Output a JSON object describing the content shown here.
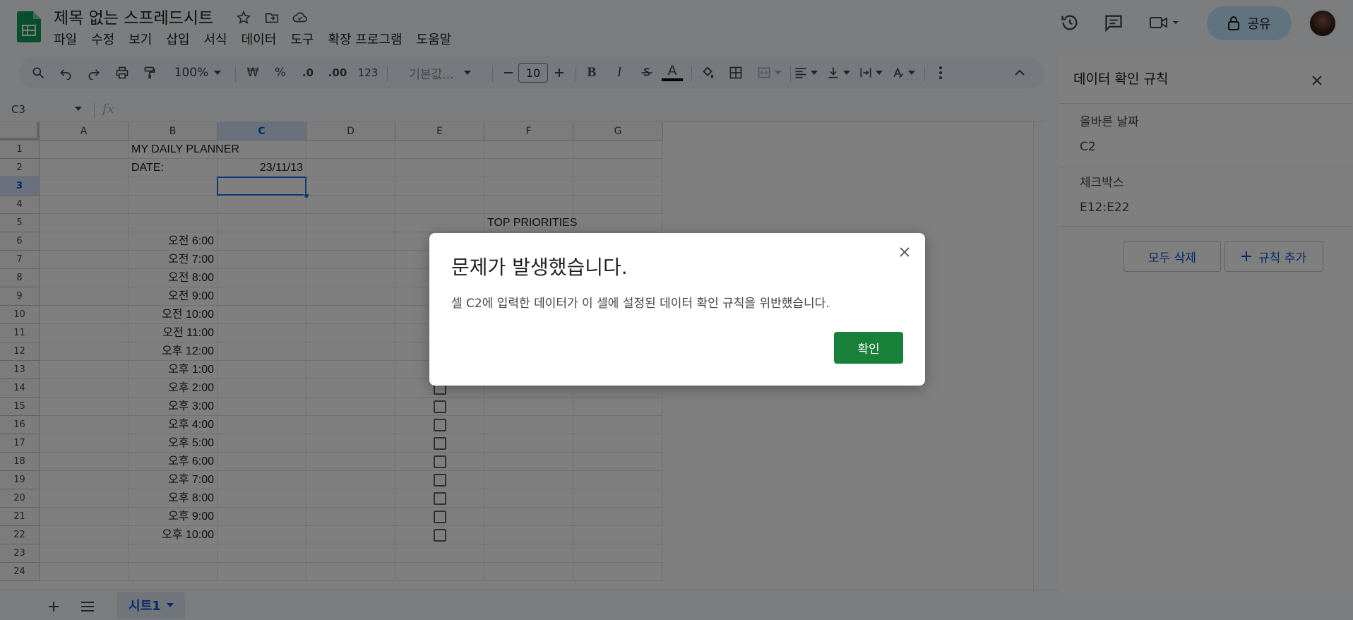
{
  "app": {
    "brand_color": "#0f9d58"
  },
  "header": {
    "doc_title": "제목 없는 스프레드시트",
    "menu": [
      "파일",
      "수정",
      "보기",
      "삽입",
      "서식",
      "데이터",
      "도구",
      "확장 프로그램",
      "도움말"
    ],
    "share_label": "공유"
  },
  "toolbar": {
    "zoom": "100%",
    "currency": "₩",
    "percent": "%",
    "decimal_decrease": ".0",
    "decimal_increase": ".00",
    "format_number": "123",
    "font": "기본값...",
    "font_size": "10"
  },
  "formula": {
    "namebox": "C3",
    "fx": "fx"
  },
  "grid": {
    "columns": [
      "A",
      "B",
      "C",
      "D",
      "E",
      "F",
      "G"
    ],
    "rows": [
      "1",
      "2",
      "3",
      "4",
      "5",
      "6",
      "7",
      "8",
      "9",
      "10",
      "11",
      "12",
      "13",
      "14",
      "15",
      "16",
      "17",
      "18",
      "19",
      "20",
      "21",
      "22",
      "23",
      "24"
    ],
    "cells": {
      "b1": "MY DAILY PLANNER",
      "b2": "DATE:",
      "c2": "23/11/13",
      "f5": "TOP PRIORITIES"
    },
    "times": [
      "오전 6:00",
      "오전 7:00",
      "오전 8:00",
      "오전 9:00",
      "오전 10:00",
      "오전 11:00",
      "오후 12:00",
      "오후 1:00",
      "오후 2:00",
      "오후 3:00",
      "오후 4:00",
      "오후 5:00",
      "오후 6:00",
      "오후 7:00",
      "오후 8:00",
      "오후 9:00",
      "오후 10:00"
    ],
    "selected_cell": "C3"
  },
  "sheets": {
    "active": "시트1"
  },
  "panel": {
    "title": "데이터 확인 규칙",
    "rules": [
      {
        "name": "올바른 날짜",
        "range": "C2"
      },
      {
        "name": "체크박스",
        "range": "E12:E22"
      }
    ],
    "delete_all": "모두 삭제",
    "add_rule": "규칙 추가"
  },
  "dialog": {
    "title": "문제가 발생했습니다.",
    "message": "셀 C2에 입력한 데이터가 이 셀에 설정된 데이터 확인 규칙을 위반했습니다.",
    "ok_label": "확인"
  }
}
